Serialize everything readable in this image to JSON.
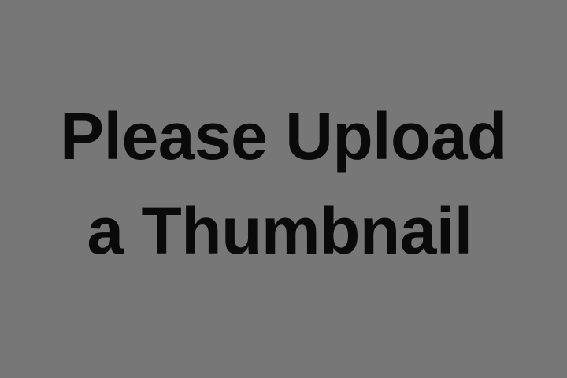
{
  "placeholder": {
    "background_color": "#777777",
    "text_color": "#0a0a0a",
    "lines": [
      "Please Upload",
      "a Thumbnail"
    ]
  }
}
